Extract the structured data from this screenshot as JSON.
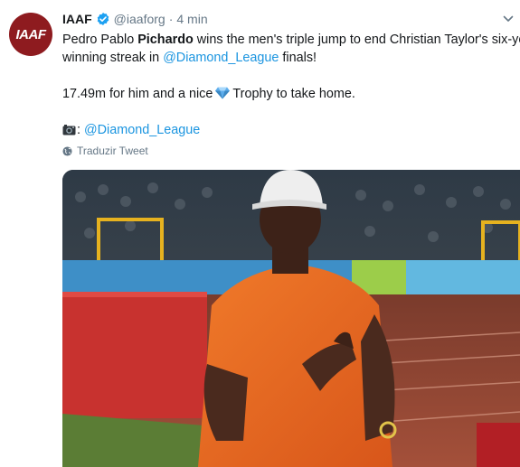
{
  "tweet": {
    "author_name": "IAAF",
    "handle": "@iaaforg",
    "separator": "·",
    "time": "4 min",
    "avatar_text": "IAAF",
    "text": {
      "l1_a": "Pedro Pablo ",
      "l1_b": "Pichardo",
      "l1_c": " wins the men's triple jump to end Christian Taylor's six-year",
      "l2_a": "winning streak in ",
      "l2_mention": "@Diamond_League",
      "l2_b": " finals!",
      "l3_a": "17.49m for him and a nice",
      "l3_b": "Trophy to take home.",
      "l4_a": ": ",
      "l4_mention": "@Diamond_League"
    },
    "translate_label": "Traduzir Tweet",
    "icons": {
      "verified": "verified-badge-icon",
      "menu": "chevron-down-icon",
      "gem": "gem-emoji",
      "camera": "camera-emoji",
      "globe": "globe-icon"
    },
    "colors": {
      "link": "#1b95e0",
      "secondary": "#657786",
      "avatar_bg": "#8e1b1f"
    }
  }
}
